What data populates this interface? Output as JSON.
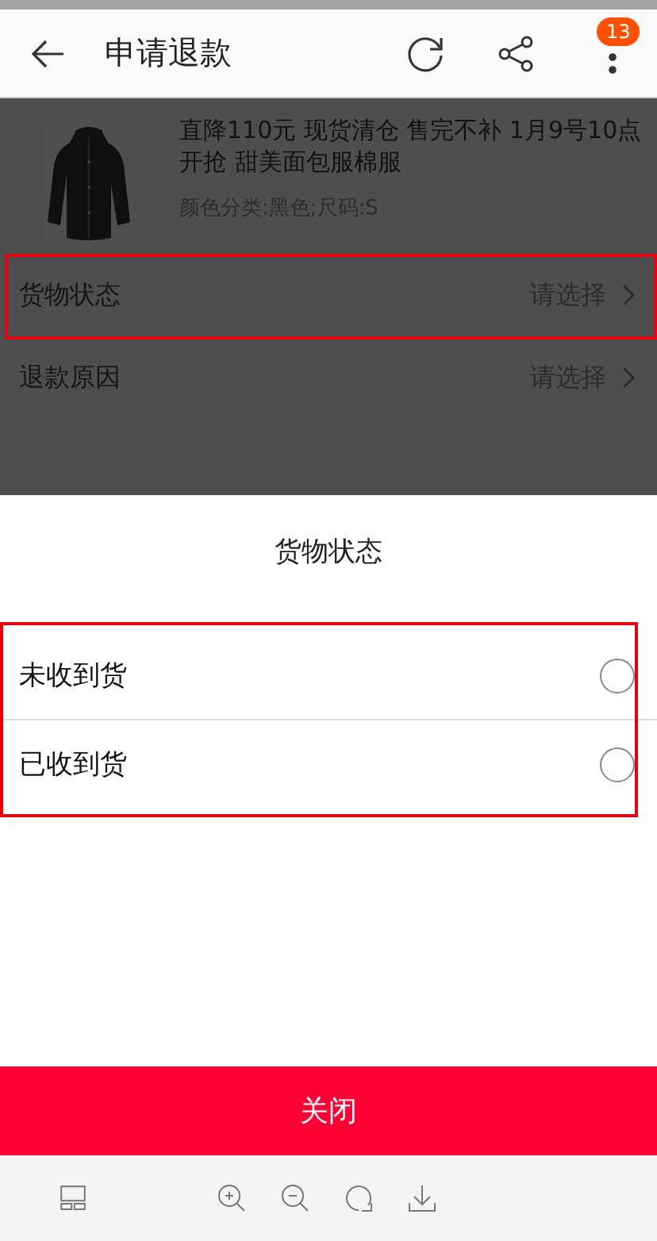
{
  "header": {
    "title": "申请退款",
    "badge": "13"
  },
  "product": {
    "title": "直降110元 现货清仓 售完不补 1月9号10点开抢 甜美面包服棉服",
    "spec": "颜色分类:黑色;尺码:S"
  },
  "form_rows": [
    {
      "label": "货物状态",
      "value": "请选择",
      "highlighted": true
    },
    {
      "label": "退款原因",
      "value": "请选择",
      "highlighted": false
    }
  ],
  "sheet": {
    "title": "货物状态",
    "options_highlighted": true,
    "options": [
      {
        "label": "未收到货",
        "selected": false
      },
      {
        "label": "已收到货",
        "selected": false
      }
    ],
    "close_button": "关闭"
  }
}
